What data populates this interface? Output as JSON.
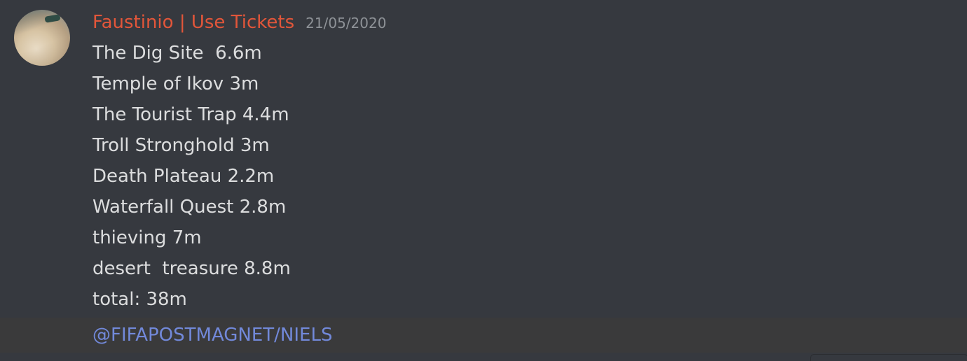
{
  "message": {
    "author": "Faustinio | Use Tickets",
    "timestamp": "21/05/2020",
    "avatar_icon": "sandy-landscape-avatar",
    "lines": [
      "The Dig Site  6.6m",
      "Temple of Ikov 3m",
      "The Tourist Trap 4.4m",
      "Troll Stronghold 3m",
      "Death Plateau 2.2m",
      "Waterfall Quest 2.8m",
      "thieving 7m",
      "desert  treasure 8.8m",
      "total: 38m"
    ],
    "mention": "@FIFAPOSTMAGNET/NIELS"
  },
  "colors": {
    "background": "#36393f",
    "username": "#e2563a",
    "timestamp": "#8e9297",
    "text": "#dcddde",
    "mention": "#7289da",
    "mention_row": "#3a3a3b"
  }
}
